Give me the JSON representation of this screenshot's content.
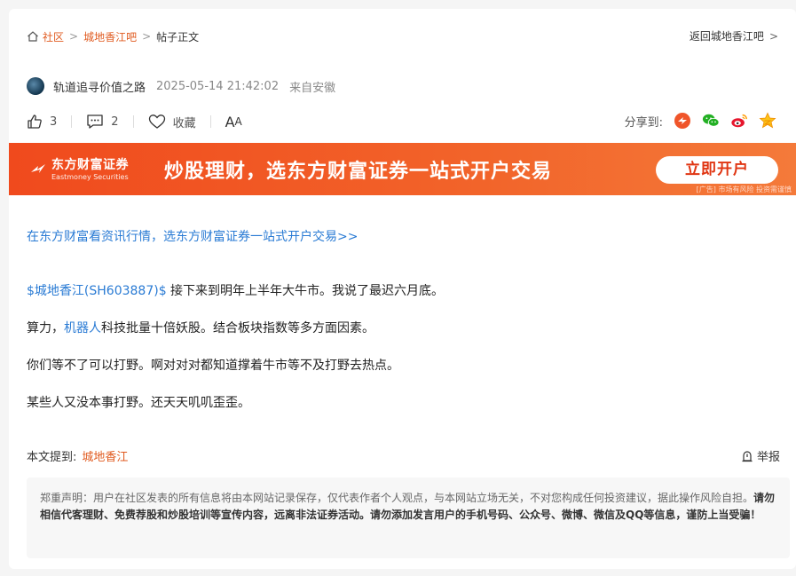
{
  "breadcrumb": {
    "home": "社区",
    "forum": "城地香江吧",
    "current": "帖子正文",
    "back": "返回城地香江吧"
  },
  "author": {
    "name": "轨道追寻价值之路",
    "time": "2025-05-14 21:42:02",
    "source": "来自安徽"
  },
  "actions": {
    "likes": "3",
    "comments": "2",
    "favorite": "收藏",
    "font_big": "A",
    "font_small": "A"
  },
  "share": {
    "label": "分享到:"
  },
  "banner": {
    "logo_cn": "东方财富证券",
    "logo_en": "Eastmoney Securities",
    "slogan": "炒股理财，选东方财富证券一站式开户交易",
    "cta": "立即开户",
    "note": "[广告] 市场有风险 投资需谨慎"
  },
  "post": {
    "lead_link": "在东方财富看资讯行情，选东方财富证券一站式开户交易>>",
    "p1_stock": "$城地香江(SH603887)$",
    "p1_text": " 接下来到明年上半年大牛市。我说了最迟六月底。",
    "p2_pre": "算力，",
    "p2_kw": "机器人",
    "p2_text": "科技批量十倍妖股。结合板块指数等多方面因素。",
    "p3": "你们等不了可以打野。啊对对对都知道撑着牛市等不及打野去热点。",
    "p4": "某些人又没本事打野。还天天叽叽歪歪。"
  },
  "mention": {
    "label": "本文提到:",
    "tag": "城地香江"
  },
  "report": "举报",
  "disclaimer": {
    "normal": "郑重声明：用户在社区发表的所有信息将由本网站记录保存，仅代表作者个人观点，与本网站立场无关，不对您构成任何投资建议，据此操作风险自担。",
    "bold": "请勿相信代客理财、免费荐股和炒股培训等宣传内容，远离非法证券活动。请勿添加发言用户的手机号码、公众号、微博、微信及QQ等信息，谨防上当受骗！"
  }
}
